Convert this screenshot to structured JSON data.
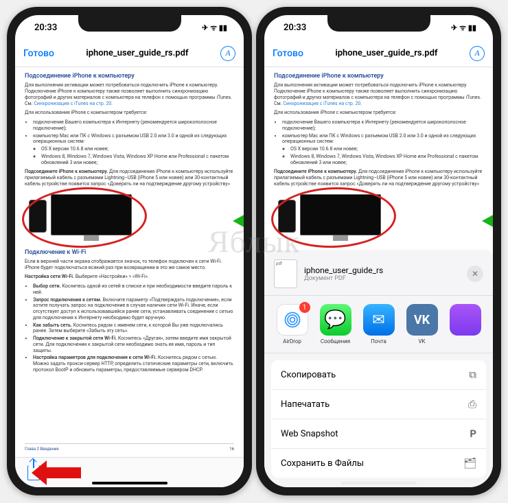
{
  "status": {
    "time": "20:33"
  },
  "nav": {
    "done": "Готово",
    "title": "iphone_user_guide_rs.pdf"
  },
  "doc": {
    "h1": "Подсоединение iPhone к компьютеру",
    "p1": "Для выполнения активации может потребоваться подключить iPhone к компьютеру. Подключение iPhone к компьютеру также позволяет выполнить синхронизацию фотографий и других материалов с компьютера на телефон с помощью программы iTunes. См.",
    "p1link": "Синхронизация с iTunes на стр. 20.",
    "p2": "Для использования iPhone с компьютером требуется:",
    "b1": "подключение Вашего компьютера к Интернету (рекомендуется широкополосное подключение);",
    "b2": "компьютер Mac или ПК с Windows с разъемом USB 2.0 или 3.0 и одной из следующих операционных систем:",
    "b2a": "OS X версии 10.6.8 или новее;",
    "b2b": "Windows 8, Windows 7, Windows Vista, Windows XP Home или Professional с пакетом обновлений 3 или новее;",
    "p3a": "Подсоедините iPhone к компьютеру.",
    "p3b": "Для подсоединения iPhone к компьютеру используйте прилагаемый кабель с разъемами Lightning–USB (iPhone 5 или новее) или 30-контактный кабель",
    "p3c": "устройстве появится запрос «Доверять ли на подтверждение",
    "p3d": "другому устройству»",
    "h2": "Подключение к Wi-Fi",
    "p4": "Если в верхней части экрана отображается значок, то телефон подключен к сети Wi-Fi. iPhone будет подключаться всякий раз при возвращении в это же самое место.",
    "p5a": "Настройка сети Wi-Fi.",
    "p5b": "Выберите «Настройки» > «Wi-Fi».",
    "b3a": "Выбор сети.",
    "b3b": "Коснитесь одной из сетей в списке и при необходимости введите пароль к ней.",
    "b4a": "Запрос подключения к сетям.",
    "b4b": "Включите параметр «Подтверждать подключение», если хотите получать запрос на подключение в случае наличия сети Wi-Fi. Иначе, если отсутствует доступ к использовавшейся ранее сети, устанавливать соединение с сетью для подключения к Интернету необходимо будет вручную.",
    "b5a": "Как забыть сеть.",
    "b5b": "Коснитесь рядом с именем сети, к которой Вы уже подключались ранее. Затем выберите «Забыть эту сеть».",
    "b6a": "Подключение к закрытой сети Wi-Fi.",
    "b6b": "Коснитесь «Другая», затем введите имя закрытой сети. Для подключения к закрытой сети необходимо знать ее имя, пароль и тип защиты.",
    "b7a": "Настройка параметров для подключения к сети Wi-Fi.",
    "b7b": "Коснитесь рядом с сетью. Можно задать прокси-сервер HTTP, определить статические параметры сети, включить протокол BootP и обновить параметры, предоставляемые сервером DHCP.",
    "footer_left": "Глава 2    Введение",
    "footer_right": "16"
  },
  "sheet": {
    "title": "iphone_user_guide_rs",
    "subtitle": "Документ PDF",
    "thumb_label": "pdf",
    "apps": {
      "airdrop": "AirDrop",
      "messages": "Сообщения",
      "mail": "Почта",
      "vk": "VK",
      "badge": "1"
    },
    "actions": {
      "copy": "Скопировать",
      "print": "Напечатать",
      "web_snapshot": "Web Snapshot",
      "save_files": "Сохранить в Файлы"
    }
  },
  "watermark": "Яблык"
}
